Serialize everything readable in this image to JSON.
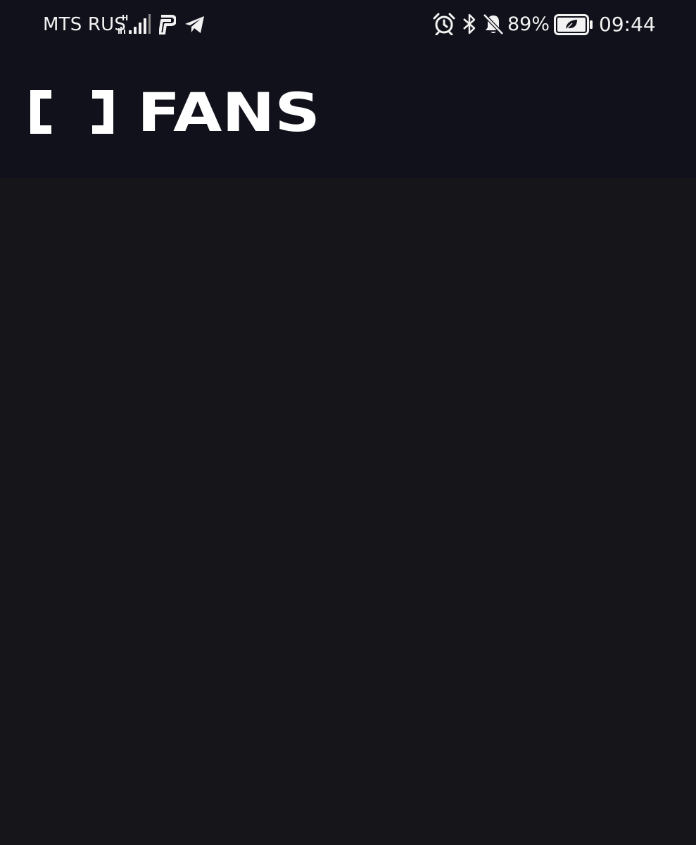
{
  "status_bar": {
    "carrier": "MTS RUS",
    "network_type": "H",
    "battery_percent": "89%",
    "time": "09:44",
    "icons": [
      "signal-icon",
      "parking-app-icon",
      "telegram-icon",
      "alarm-icon",
      "bluetooth-icon",
      "bell-muted-icon",
      "battery-saver-icon"
    ]
  },
  "header": {
    "logo_text": "FANS"
  },
  "colors": {
    "header_background": "#11111b",
    "content_background": "#16151a",
    "text": "#ffffff"
  }
}
